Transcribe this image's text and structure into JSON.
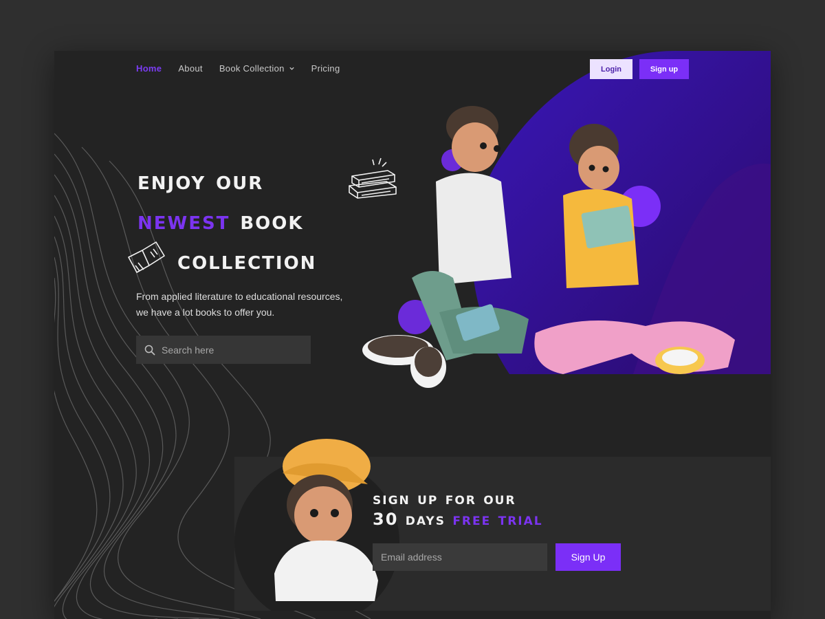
{
  "nav": {
    "items": [
      {
        "label": "Home",
        "active": true
      },
      {
        "label": "About",
        "active": false
      },
      {
        "label": "Book Collection",
        "active": false,
        "icon": "chevron-down-icon"
      },
      {
        "label": "Pricing",
        "active": false
      }
    ],
    "login_label": "Login",
    "signup_label": "Sign up"
  },
  "hero": {
    "line1": "Enjoy our",
    "line2_accent": "Newest",
    "line2_rest": "Book",
    "line3": "Collection",
    "subtitle_line1": "From applied literature to educational resources,",
    "subtitle_line2": "we have a lot books to offer you.",
    "search_placeholder": "Search here"
  },
  "trial": {
    "line1": "Sign up for our",
    "line2_prefix": "30 Days",
    "line2_accent": "Free Trial",
    "email_placeholder": "Email address",
    "button_label": "Sign Up"
  },
  "colors": {
    "accent": "#7b2ff7",
    "background": "#232323",
    "login_bg": "#ece2ff"
  }
}
